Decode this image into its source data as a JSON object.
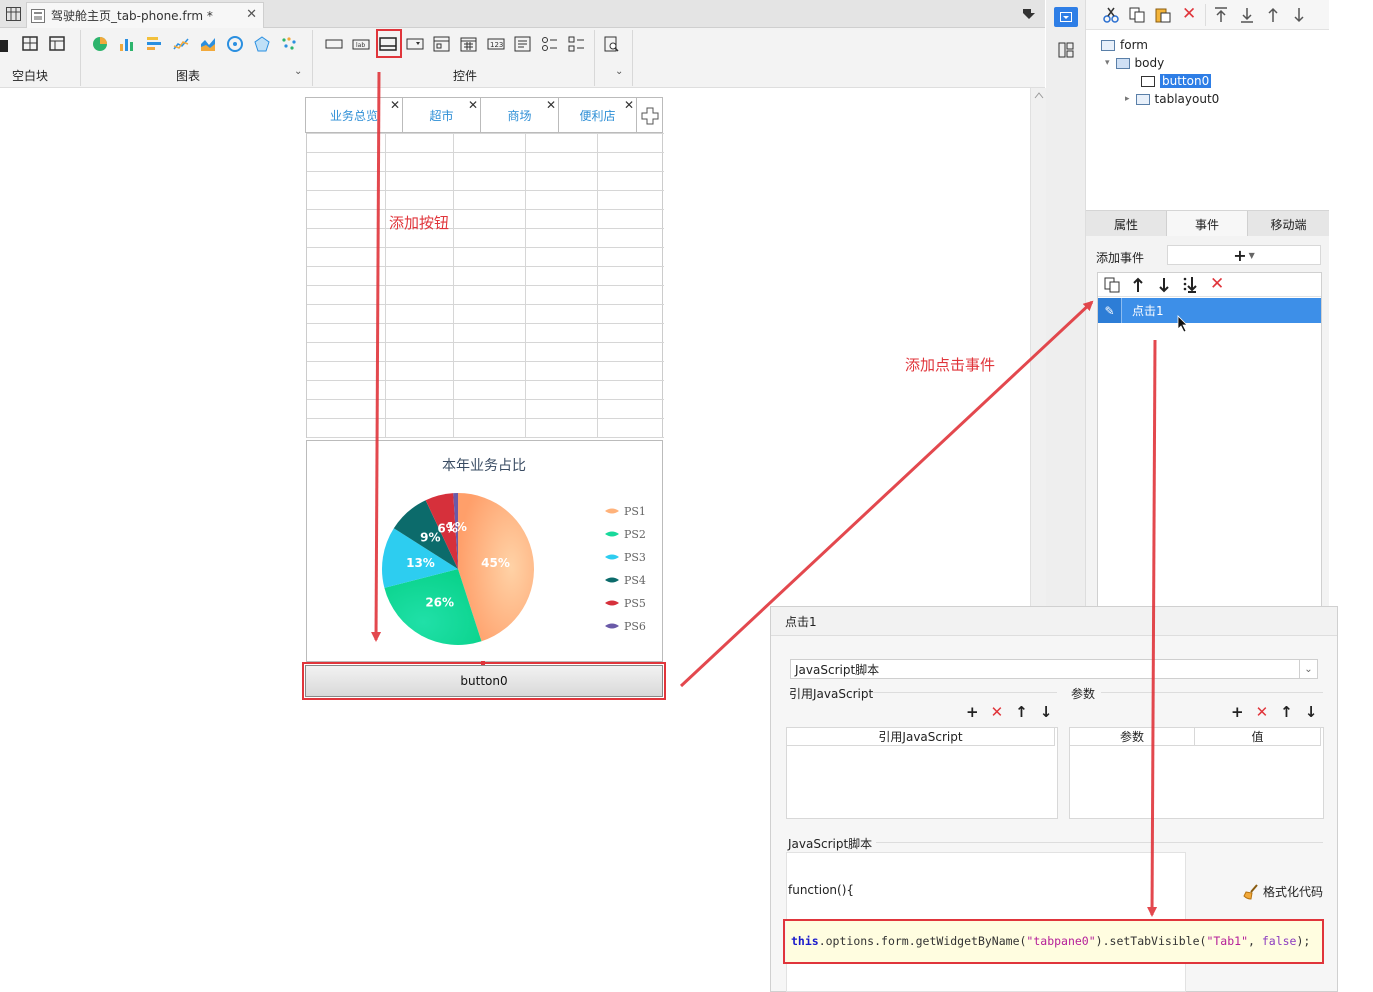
{
  "window": {
    "file_tab": "驾驶舱主页_tab-phone.frm *"
  },
  "toolbar": {
    "groups": [
      {
        "label": "空白块"
      },
      {
        "label": "图表"
      },
      {
        "label": "控件"
      }
    ]
  },
  "form": {
    "tabs": [
      "业务总览",
      "超市",
      "商场",
      "便利店"
    ],
    "button_label": "button0",
    "chart_data": {
      "type": "pie",
      "title": "本年业务占比",
      "categories": [
        "PS1",
        "PS2",
        "PS3",
        "PS4",
        "PS5",
        "PS6"
      ],
      "values": [
        45,
        26,
        13,
        9,
        6,
        1
      ],
      "data_labels": [
        "45%",
        "26%",
        "13%",
        "9%",
        "6%",
        "1%"
      ],
      "colors": [
        "#ffb27a",
        "#18d99b",
        "#2dcdf0",
        "#0c6b6b",
        "#d6303b",
        "#6a5aa8"
      ],
      "legend": "right"
    }
  },
  "tree": {
    "nodes": [
      "form",
      "body",
      "button0",
      "tablayout0"
    ]
  },
  "prop_tabs": [
    "属性",
    "事件",
    "移动端"
  ],
  "events": {
    "add_label": "添加事件",
    "add_symbol": "+",
    "list": [
      "点击1"
    ]
  },
  "dialog": {
    "title": "点击1",
    "type_value": "JavaScript脚本",
    "ref_js_label": "引用JavaScript",
    "params_label": "参数",
    "ref_js_col": "引用JavaScript",
    "param_col": "参数",
    "value_col": "值",
    "script_label": "JavaScript脚本",
    "func_open": "function(){",
    "format_label": "格式化代码",
    "code": {
      "kw": "this",
      "part1": ".options.form.getWidgetByName(",
      "str1": "\"tabpane0\"",
      "part2": ").setTabVisible(",
      "str2": "\"Tab1\"",
      "sep": ", ",
      "bool": "false",
      "end": ");"
    }
  },
  "annotations": {
    "add_button": "添加按钮",
    "add_click_event": "添加点击事件"
  },
  "accent": "#e0353b"
}
